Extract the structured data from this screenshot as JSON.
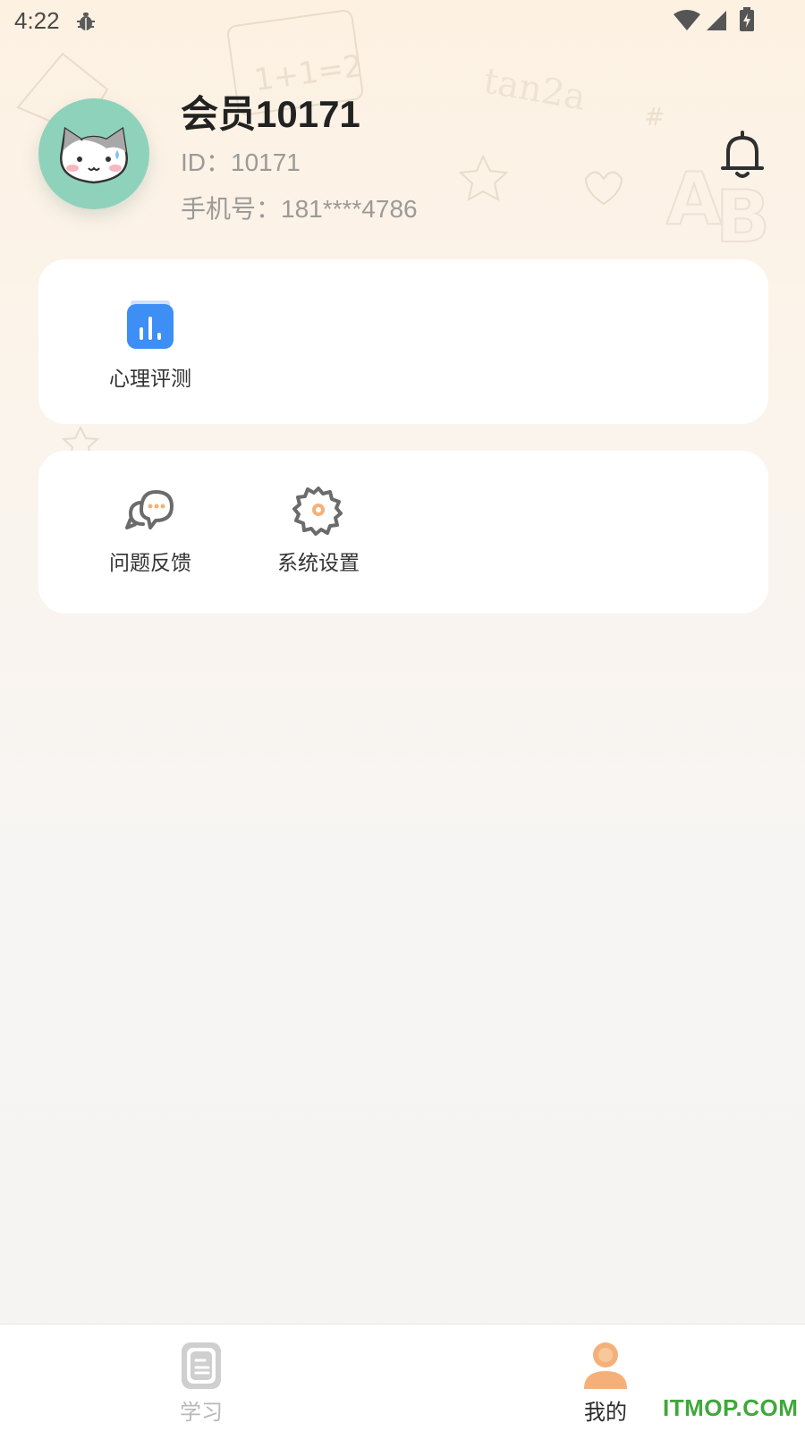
{
  "status_bar": {
    "time": "4:22",
    "icons": [
      "debug-icon",
      "wifi-icon",
      "signal-icon",
      "battery-charging-icon"
    ]
  },
  "profile": {
    "name": "会员10171",
    "id_text": "ID：10171",
    "phone_text": "手机号：181****4786",
    "avatar": "cat-avatar",
    "notification_icon": "bell-icon"
  },
  "cards": [
    {
      "items": [
        {
          "label": "心理评测",
          "icon": "bar-chart-icon",
          "color": "#3d8ef5"
        }
      ]
    },
    {
      "items": [
        {
          "label": "问题反馈",
          "icon": "chat-bubbles-icon",
          "color": "#6b6b6b"
        },
        {
          "label": "系统设置",
          "icon": "gear-icon",
          "color": "#6b6b6b"
        }
      ]
    }
  ],
  "bottom_nav": {
    "items": [
      {
        "label": "学习",
        "icon": "book-icon",
        "active": false
      },
      {
        "label": "我的",
        "icon": "user-icon",
        "active": true
      }
    ]
  },
  "colors": {
    "accent_blue": "#3d8ef5",
    "accent_orange": "#f5b07a",
    "avatar_bg": "#8fd2bc",
    "watermark_green": "#3fa83a"
  },
  "watermark": "ITMOP.COM"
}
